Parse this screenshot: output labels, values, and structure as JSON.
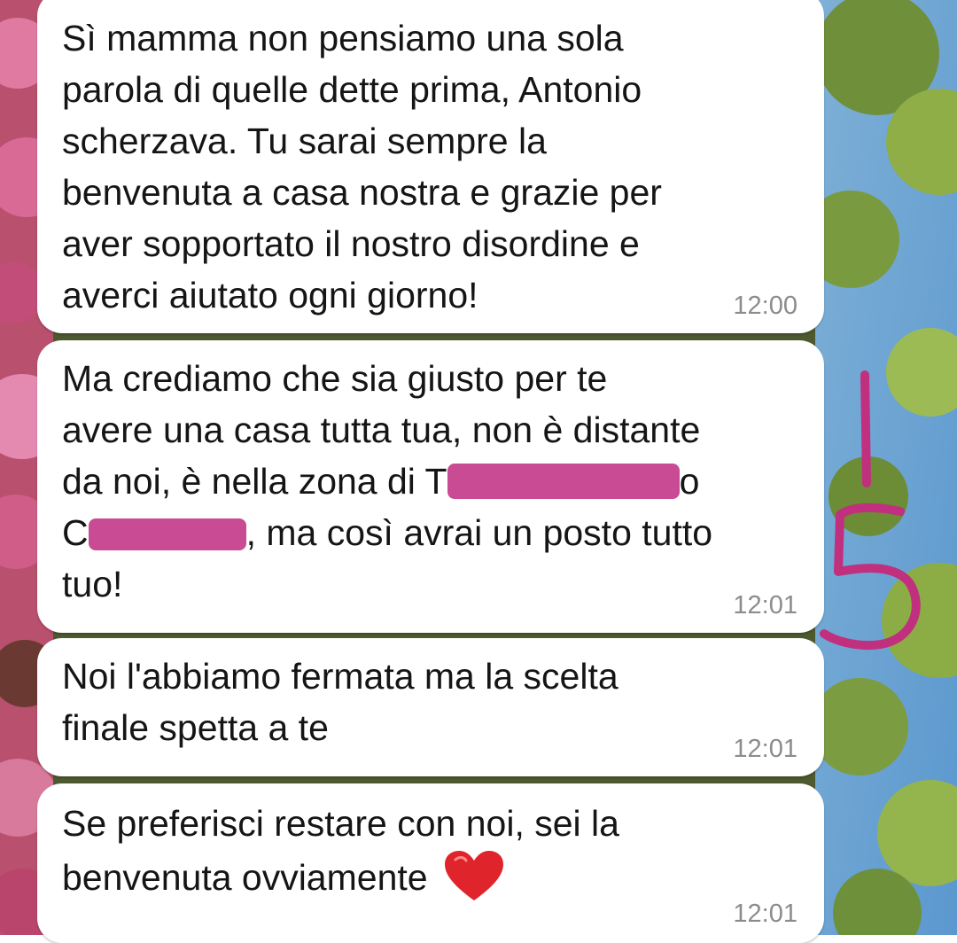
{
  "messages": [
    {
      "lines": [
        "Sì mamma non pensiamo una sola",
        "parola di quelle dette prima, Antonio",
        "scherzava. Tu sarai sempre la",
        "benvenuta a casa nostra e grazie per",
        "aver sopportato il nostro disordine e",
        "averci aiutato ogni giorno!"
      ],
      "time": "12:00"
    },
    {
      "line1": "Ma crediamo che sia giusto per te",
      "line2": "avere una casa tutta tua, non è distante",
      "line3_prefix": "da noi, è nella zona di T",
      "line3_suffix": "o",
      "line4_prefix": "C",
      "line4_suffix": ", ma così avrai un posto tutto",
      "line5": "tuo!",
      "time": "12:01"
    },
    {
      "lines": [
        "Noi l'abbiamo fermata ma la scelta",
        "finale spetta a te"
      ],
      "time": "12:01"
    },
    {
      "line1": "Se preferisci restare con noi, sei la",
      "line2": "benvenuta ovviamente",
      "emoji": "heart-emoji",
      "time": "12:01"
    }
  ],
  "annotation": {
    "text": "15",
    "color": "#c0307f"
  },
  "colors": {
    "bubble": "#ffffff",
    "text": "#151515",
    "timestamp": "#8c8c8c",
    "redaction": "#c94b93"
  }
}
